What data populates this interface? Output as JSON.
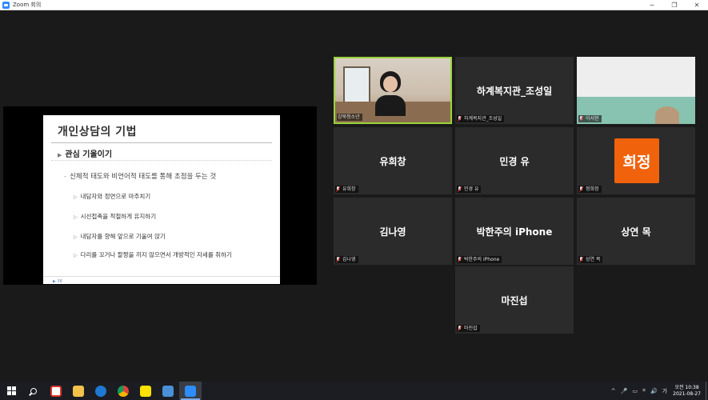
{
  "window": {
    "title": "Zoom 회의",
    "controls": [
      "─",
      "❐",
      "✕"
    ]
  },
  "shared_slide": {
    "title": "개인상담의 기법",
    "heading": "관심 기울이기",
    "heading_bullet": "▶",
    "point": "신체적 태도와 비언어적 태도를 통해 초점을 두는 것",
    "point_dash": "-",
    "sub_bullet": "▷",
    "subpoints": [
      "내담자와 정면으로 마주치기",
      "시선접촉을 적절하게 유지하기",
      "내담자를 향해 앞으로 기울여 앉기",
      "다리를 꼬거나 팔짱을 끼지 않으면서 개방적인 자세를 취하기"
    ],
    "page_number": "▶ 38"
  },
  "participants": [
    {
      "label": "강북청소년",
      "display_name": "",
      "has_video": true,
      "active_speaker": true
    },
    {
      "label": "하계복지관_조성일",
      "display_name": "하계복지관_조성일",
      "has_video": false,
      "muted": true
    },
    {
      "label": "이서현",
      "display_name": "",
      "has_video": true,
      "muted": true
    },
    {
      "label": "유희창",
      "display_name": "유희창",
      "has_video": false,
      "muted": true
    },
    {
      "label": "민경 유",
      "display_name": "민경 유",
      "has_video": false,
      "muted": true
    },
    {
      "label": "정희정",
      "display_name": "",
      "avatar_text": "희정",
      "avatar_color": "#f0620c",
      "has_video": false,
      "muted": true
    },
    {
      "label": "김나영",
      "display_name": "김나영",
      "has_video": false,
      "muted": true
    },
    {
      "label": "박한주의 iPhone",
      "display_name": "박한주의 iPhone",
      "has_video": false,
      "muted": true
    },
    {
      "label": "상연 목",
      "display_name": "상연 목",
      "has_video": false,
      "muted": true
    },
    {
      "label": "마진섭",
      "display_name": "마진섭",
      "has_video": false,
      "muted": true
    }
  ],
  "colors": {
    "active_border": "#9bd43a",
    "tile_bg": "#2b2b2b",
    "mute_red": "#e02828",
    "zoom_blue": "#2d8cff"
  },
  "taskbar": {
    "apps": [
      "start-icon",
      "search-icon",
      "chrome-remote-icon",
      "file-explorer-icon",
      "edge-icon",
      "chrome-icon",
      "kakaotalk-icon",
      "office-icon",
      "zoom-icon"
    ],
    "tray_icons": [
      "^",
      "🎤",
      "▭",
      "⌗",
      "🔊",
      "가"
    ],
    "clock_time": "오전 10:38",
    "clock_date": "2021-08-27"
  }
}
